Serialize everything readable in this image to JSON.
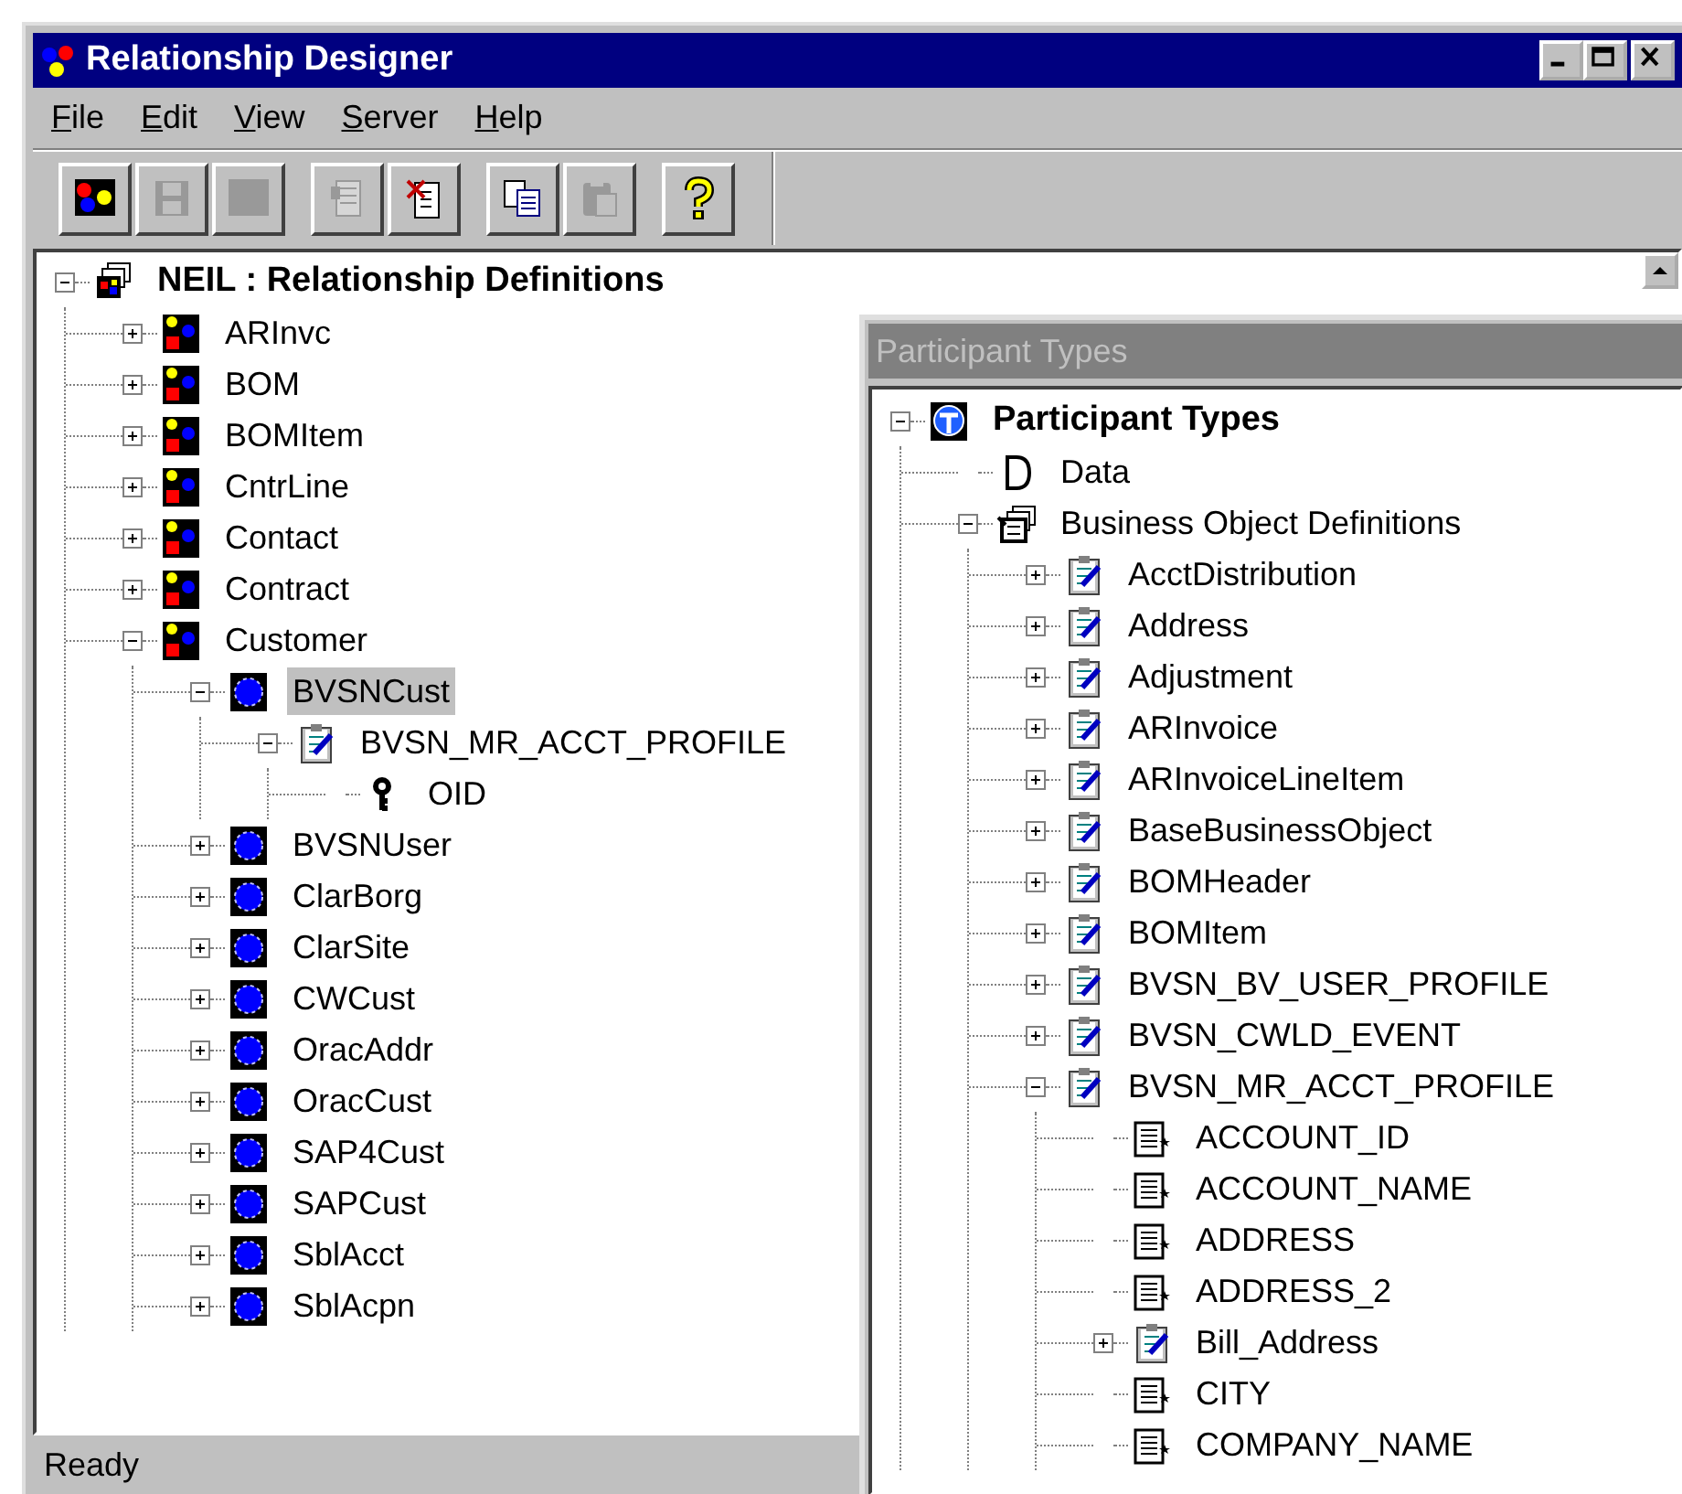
{
  "window": {
    "title": "Relationship Designer"
  },
  "menu": [
    "File",
    "Edit",
    "View",
    "Server",
    "Help"
  ],
  "toolbar": [
    [
      {
        "kind": "logo",
        "disabled": false
      },
      {
        "kind": "save",
        "disabled": true
      },
      {
        "kind": "blank",
        "disabled": true
      }
    ],
    [
      {
        "kind": "properties",
        "disabled": true
      },
      {
        "kind": "delete",
        "disabled": false
      }
    ],
    [
      {
        "kind": "copy",
        "disabled": false
      },
      {
        "kind": "paste",
        "disabled": true
      }
    ],
    [
      {
        "kind": "help",
        "disabled": false
      }
    ]
  ],
  "relationship_tree": [
    {
      "label": "NEIL : Relationship Definitions",
      "kind": "root",
      "expanded": true,
      "selected": false,
      "children": [
        {
          "label": "ARInvc",
          "kind": "relationship",
          "expanded": false,
          "selected": false
        },
        {
          "label": "BOM",
          "kind": "relationship",
          "expanded": false,
          "selected": false
        },
        {
          "label": "BOMItem",
          "kind": "relationship",
          "expanded": false,
          "selected": false
        },
        {
          "label": "CntrLine",
          "kind": "relationship",
          "expanded": false,
          "selected": false
        },
        {
          "label": "Contact",
          "kind": "relationship",
          "expanded": false,
          "selected": false
        },
        {
          "label": "Contract",
          "kind": "relationship",
          "expanded": false,
          "selected": false
        },
        {
          "label": "Customer",
          "kind": "relationship",
          "expanded": true,
          "selected": false,
          "children": [
            {
              "label": "BVSNCust",
              "kind": "participant",
              "expanded": true,
              "selected": true,
              "children": [
                {
                  "label": "BVSN_MR_ACCT_PROFILE",
                  "kind": "business-object",
                  "expanded": true,
                  "selected": false,
                  "children": [
                    {
                      "label": "OID",
                      "kind": "key",
                      "selected": false
                    }
                  ]
                }
              ]
            },
            {
              "label": "BVSNUser",
              "kind": "participant",
              "expanded": false,
              "selected": false
            },
            {
              "label": "ClarBorg",
              "kind": "participant",
              "expanded": false,
              "selected": false
            },
            {
              "label": "ClarSite",
              "kind": "participant",
              "expanded": false,
              "selected": false
            },
            {
              "label": "CWCust",
              "kind": "participant",
              "expanded": false,
              "selected": false
            },
            {
              "label": "OracAddr",
              "kind": "participant",
              "expanded": false,
              "selected": false
            },
            {
              "label": "OracCust",
              "kind": "participant",
              "expanded": false,
              "selected": false
            },
            {
              "label": "SAP4Cust",
              "kind": "participant",
              "expanded": false,
              "selected": false
            },
            {
              "label": "SAPCust",
              "kind": "participant",
              "expanded": false,
              "selected": false
            },
            {
              "label": "SblAcct",
              "kind": "participant",
              "expanded": false,
              "selected": false
            },
            {
              "label": "SblAcpn",
              "kind": "participant",
              "expanded": false,
              "selected": false
            }
          ]
        }
      ]
    }
  ],
  "status_bar": "Ready",
  "participant_window": {
    "title": "Participant Types",
    "tree": [
      {
        "label": "Participant Types",
        "kind": "participant-types",
        "expanded": true,
        "selected": false,
        "children": [
          {
            "label": "Data",
            "kind": "data",
            "selected": false
          },
          {
            "label": "Business Object Definitions",
            "kind": "bo-folder",
            "expanded": true,
            "selected": false,
            "children": [
              {
                "label": "AcctDistribution",
                "kind": "business-object",
                "expanded": false,
                "selected": false
              },
              {
                "label": "Address",
                "kind": "business-object",
                "expanded": false,
                "selected": false
              },
              {
                "label": "Adjustment",
                "kind": "business-object",
                "expanded": false,
                "selected": false
              },
              {
                "label": "ARInvoice",
                "kind": "business-object",
                "expanded": false,
                "selected": false
              },
              {
                "label": "ARInvoiceLineItem",
                "kind": "business-object",
                "expanded": false,
                "selected": false
              },
              {
                "label": "BaseBusinessObject",
                "kind": "business-object",
                "expanded": false,
                "selected": false
              },
              {
                "label": "BOMHeader",
                "kind": "business-object",
                "expanded": false,
                "selected": false
              },
              {
                "label": "BOMItem",
                "kind": "business-object",
                "expanded": false,
                "selected": false
              },
              {
                "label": "BVSN_BV_USER_PROFILE",
                "kind": "business-object",
                "expanded": false,
                "selected": false
              },
              {
                "label": "BVSN_CWLD_EVENT",
                "kind": "business-object",
                "expanded": false,
                "selected": false
              },
              {
                "label": "BVSN_MR_ACCT_PROFILE",
                "kind": "business-object",
                "expanded": true,
                "selected": false,
                "children": [
                  {
                    "label": "ACCOUNT_ID",
                    "kind": "attribute",
                    "selected": false
                  },
                  {
                    "label": "ACCOUNT_NAME",
                    "kind": "attribute",
                    "selected": false
                  },
                  {
                    "label": "ADDRESS",
                    "kind": "attribute",
                    "selected": false
                  },
                  {
                    "label": "ADDRESS_2",
                    "kind": "attribute",
                    "selected": false
                  },
                  {
                    "label": "Bill_Address",
                    "kind": "business-object",
                    "expanded": false,
                    "selected": false
                  },
                  {
                    "label": "CITY",
                    "kind": "attribute",
                    "selected": false
                  },
                  {
                    "label": "COMPANY_NAME",
                    "kind": "attribute",
                    "selected": false
                  }
                ]
              }
            ]
          }
        ]
      }
    ]
  }
}
